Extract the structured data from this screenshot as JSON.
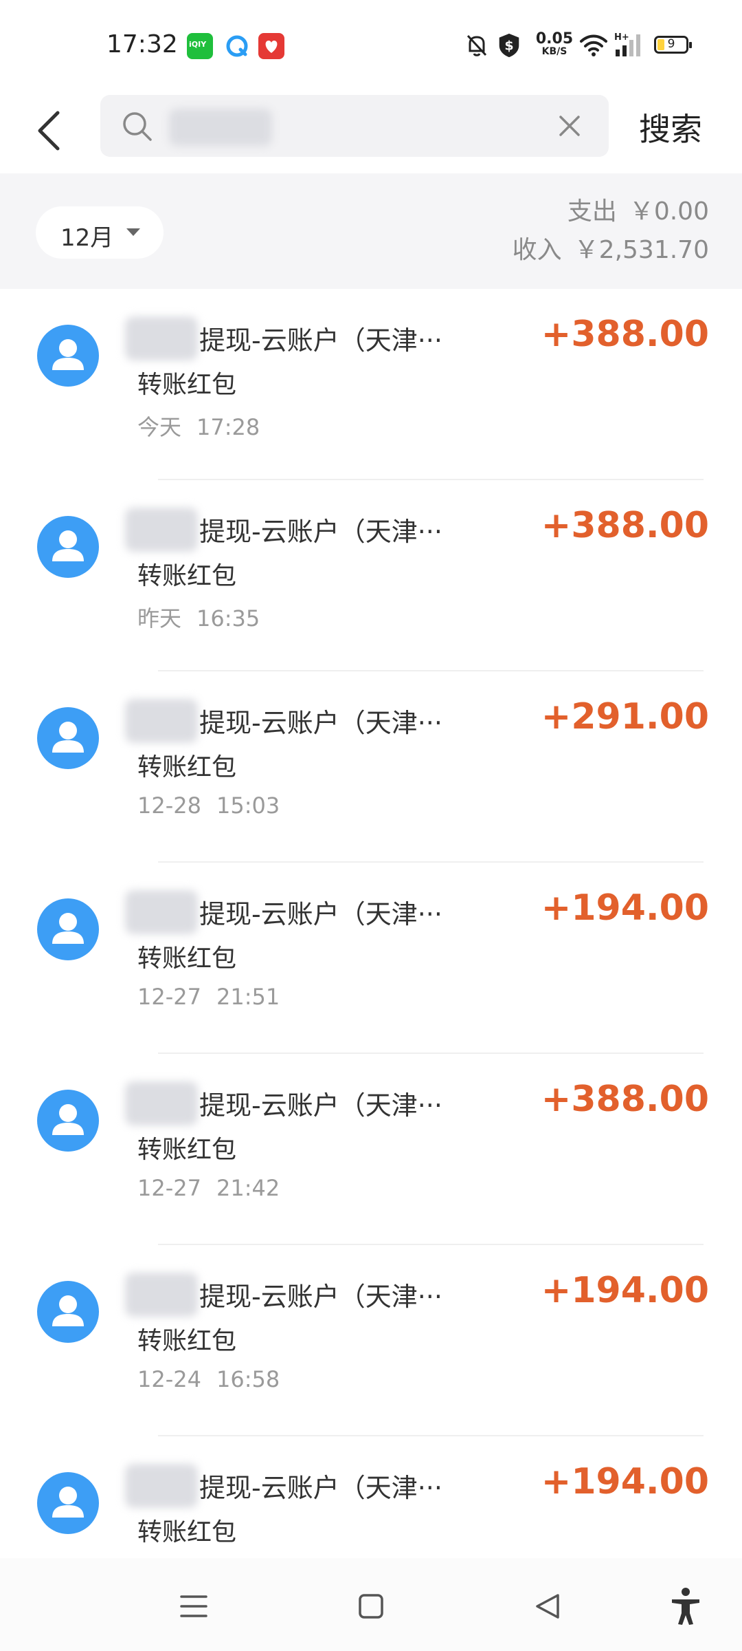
{
  "status_bar": {
    "time": "17:32",
    "apps": [
      "iqiyi-icon",
      "browser-icon",
      "shopping-icon"
    ],
    "net_speed_value": "0.05",
    "net_speed_unit": "KB/S",
    "battery_level": "9",
    "icons": [
      "mute-bell-icon",
      "shield-icon",
      "wifi-icon",
      "signal-icon",
      "battery-icon"
    ]
  },
  "header": {
    "back_icon": "chevron-left-icon",
    "search_icon": "search-icon",
    "search_value": "",
    "clear_icon": "close-icon",
    "search_button_label": "搜索"
  },
  "summary": {
    "month_label": "12月",
    "month_caret_icon": "caret-down-icon",
    "expense_label": "支出",
    "expense_value": "￥0.00",
    "income_label": "收入",
    "income_value": "￥2,531.70"
  },
  "transactions": [
    {
      "title": "提现-云账户（天津···",
      "subtitle": "转账红包",
      "date": "今天",
      "time": "17:28",
      "amount": "+388.00"
    },
    {
      "title": "提现-云账户（天津···",
      "subtitle": "转账红包",
      "date": "昨天",
      "time": "16:35",
      "amount": "+388.00"
    },
    {
      "title": "提现-云账户（天津···",
      "subtitle": "转账红包",
      "date": "12-28",
      "time": "15:03",
      "amount": "+291.00"
    },
    {
      "title": "提现-云账户（天津···",
      "subtitle": "转账红包",
      "date": "12-27",
      "time": "21:51",
      "amount": "+194.00"
    },
    {
      "title": "提现-云账户（天津···",
      "subtitle": "转账红包",
      "date": "12-27",
      "time": "21:42",
      "amount": "+388.00"
    },
    {
      "title": "提现-云账户（天津···",
      "subtitle": "转账红包",
      "date": "12-24",
      "time": "16:58",
      "amount": "+194.00"
    },
    {
      "title": "提现-云账户（天津···",
      "subtitle": "转账红包",
      "date": "",
      "time": "",
      "amount": "+194.00"
    }
  ],
  "nav_bar": {
    "icons": [
      "menu-icon",
      "home-square-icon",
      "back-triangle-icon",
      "accessibility-icon"
    ]
  },
  "colors": {
    "amount": "#e2602c",
    "avatar": "#3d9ef5",
    "summary_bg": "#f5f5f7",
    "muted_text": "#9a9a9a"
  }
}
